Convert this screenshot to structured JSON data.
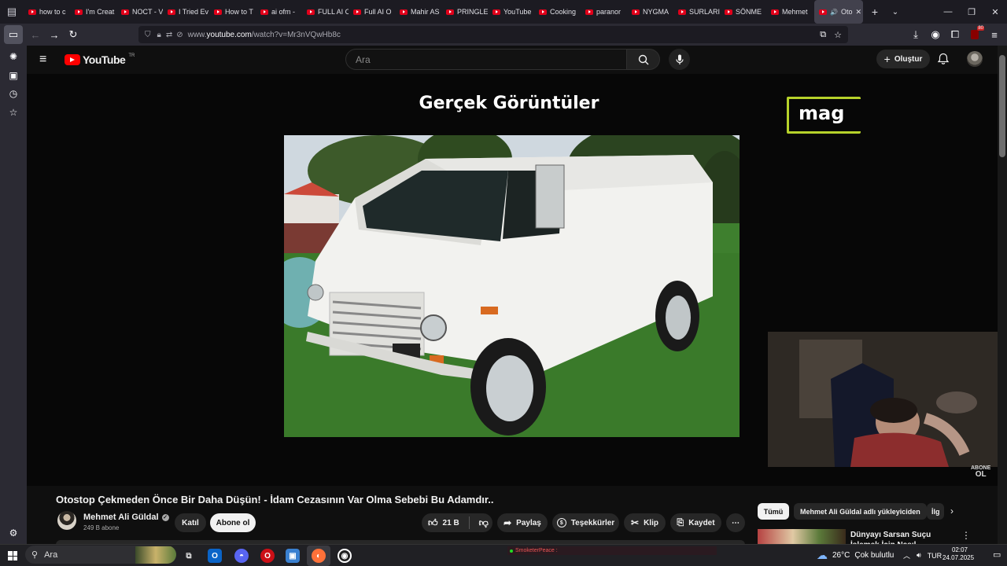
{
  "browser": {
    "tabs": [
      {
        "label": "how to c"
      },
      {
        "label": "I'm Creat"
      },
      {
        "label": "NOCT - V"
      },
      {
        "label": "I Tried Ev"
      },
      {
        "label": "How to T"
      },
      {
        "label": "ai ofm -"
      },
      {
        "label": "FULL AI C"
      },
      {
        "label": "Full AI O"
      },
      {
        "label": "Mahir AS"
      },
      {
        "label": "PRINGLE"
      },
      {
        "label": "YouTube"
      },
      {
        "label": "Cooking"
      },
      {
        "label": "paranor"
      },
      {
        "label": "NYGMA"
      },
      {
        "label": "SURLARI"
      },
      {
        "label": "SÖNME"
      },
      {
        "label": "Mehmet"
      }
    ],
    "active_tab": {
      "label": "Oto"
    },
    "url": {
      "prefix": "www.",
      "host": "youtube.com",
      "path": "/watch?v=Mr3nVQwHb8c"
    },
    "extension_badge": "80"
  },
  "youtube": {
    "logo_text": "YouTube",
    "region": "TR",
    "search_placeholder": "Ara",
    "create_label": "Oluştur"
  },
  "video": {
    "overlay_title": "Gerçek Görüntüler",
    "watermark": "mag",
    "subscribe_overlay": [
      "ABONE",
      "OL"
    ],
    "title": "Otostop Çekmeden Önce Bir Daha Düşün! - İdam Cezasının Var Olma Sebebi Bu Adamdır..",
    "channel": {
      "name": "Mehmet Ali Güldal",
      "subscribers": "249 B abone"
    },
    "join_label": "Katıl",
    "subscribe_label": "Abone ol",
    "likes": "21 B",
    "share_label": "Paylaş",
    "thanks_label": "Teşekkürler",
    "clip_label": "Klip",
    "save_label": "Kaydet"
  },
  "recommendations": {
    "chips": [
      "Tümü",
      "Mehmet Ali Güldal adlı yükleyiciden",
      "İlg"
    ],
    "first_title": "Dünyayı Sarsan Suçu İşlemek İçin Nasıl Kandırıldılar? Kim"
  },
  "taskbar": {
    "search_placeholder": "Ara",
    "stream_text": "SmoketerPeace :",
    "weather": {
      "temp": "26°C",
      "condition": "Çok bulutlu"
    },
    "lang": "TUR",
    "time": "02:07",
    "date": "24.07.2025"
  },
  "colors": {
    "youtube_red": "#ff0000",
    "watermark_border": "#b6d22a",
    "page_bg": "#0f0f0f"
  }
}
